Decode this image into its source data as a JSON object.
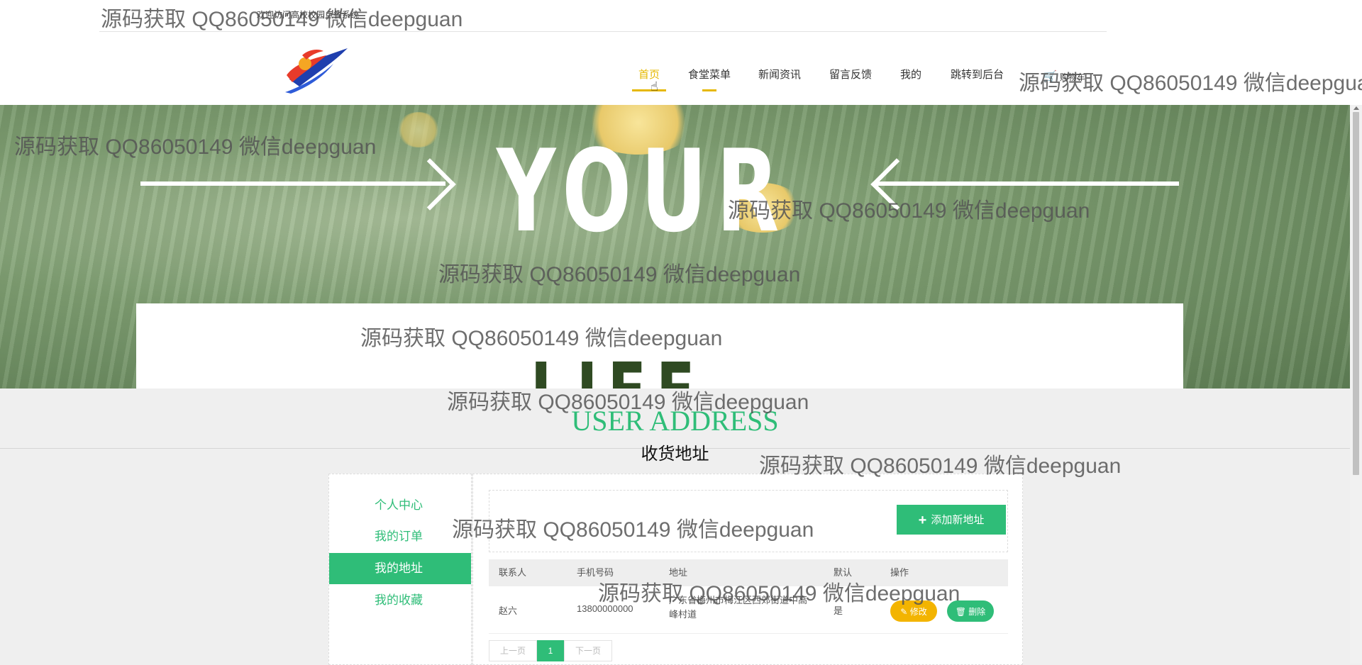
{
  "header": {
    "welcome": "欢迎访问高校校园点餐系统",
    "nav": [
      "首页",
      "食堂菜单",
      "新闻资讯",
      "留言反馈",
      "我的",
      "跳转到后台",
      "购物车"
    ]
  },
  "banner": {
    "word_top": "YOUR",
    "word_bottom": "LIFE"
  },
  "section": {
    "title_en": "USER ADDRESS",
    "title_cn": "收货地址"
  },
  "sidebar": {
    "items": [
      "个人中心",
      "我的订单",
      "我的地址",
      "我的收藏"
    ],
    "active_index": 2
  },
  "address": {
    "add_button": "添加新地址",
    "columns": [
      "联系人",
      "手机号码",
      "地址",
      "默认",
      "操作"
    ],
    "rows": [
      {
        "name": "赵六",
        "phone": "13800000000",
        "address": "广东省梅州市梅江区西郊街道中高峰村道",
        "default": "是",
        "edit": "修改",
        "delete": "删除"
      }
    ]
  },
  "pagination": {
    "prev": "上一页",
    "current": "1",
    "next": "下一页"
  },
  "watermark": "源码获取 QQ86050149 微信deepguan",
  "colors": {
    "accent_green": "#2fbd78",
    "nav_active": "#e6b800",
    "edit_button": "#f3b400"
  }
}
